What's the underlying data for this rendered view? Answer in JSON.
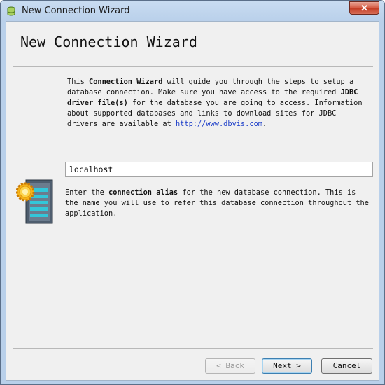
{
  "window": {
    "title": "New Connection Wizard",
    "close_glyph": "✕"
  },
  "page": {
    "heading": "New Connection Wizard"
  },
  "intro": {
    "p1": "This ",
    "b1": "Connection Wizard",
    "p2": " will guide you through the steps to setup a database connection. Make sure you have access to the required ",
    "b2": "JDBC driver file(s)",
    "p3": " for the database you are going to access. Information about supported databases and links to download sites for JDBC drivers are available at ",
    "link": "http://www.dbvis.com",
    "p4": "."
  },
  "alias": {
    "value": "localhost",
    "help_p1": "Enter the ",
    "help_b": "connection alias",
    "help_p2": " for the new database connection. This is the name you will use to refer this database connection throughout the application."
  },
  "buttons": {
    "back": "< Back",
    "next": "Next >",
    "cancel": "Cancel"
  },
  "icons": {
    "app": "database-icon",
    "wizard": "server-database-icon",
    "close": "close-icon"
  },
  "colors": {
    "link": "#1a3cc8",
    "title_bar": "#b9d0ea",
    "close": "#c23a22"
  }
}
